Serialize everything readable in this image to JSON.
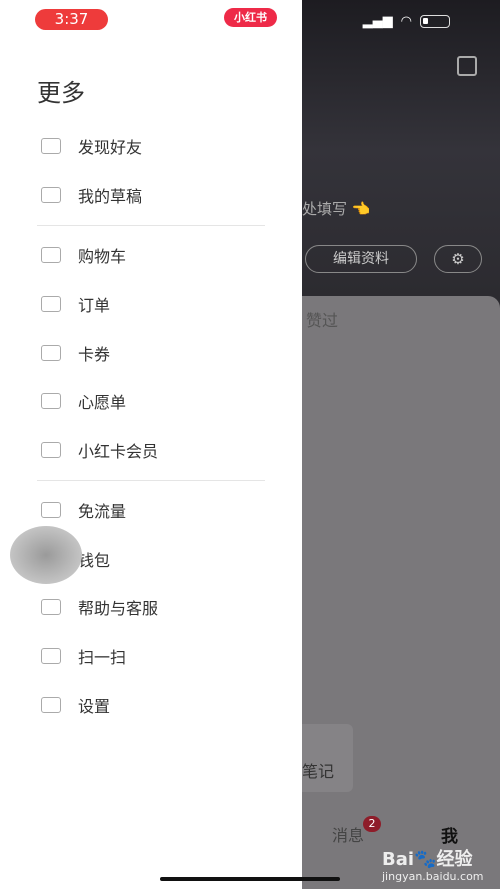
{
  "status": {
    "time": "3:37",
    "app_badge": "小红书"
  },
  "drawer": {
    "title": "更多",
    "items": [
      {
        "label": "发现好友",
        "icon": "add-user-icon"
      },
      {
        "label": "我的草稿",
        "icon": "inbox-icon"
      },
      {
        "label": "购物车",
        "icon": "cart-icon"
      },
      {
        "label": "订单",
        "icon": "order-icon"
      },
      {
        "label": "卡券",
        "icon": "coupon-icon"
      },
      {
        "label": "心愿单",
        "icon": "wishlist-icon"
      },
      {
        "label": "小红卡会员",
        "icon": "member-icon"
      },
      {
        "label": "免流量",
        "icon": "data-icon"
      },
      {
        "label": "钱包",
        "icon": "wallet-icon"
      },
      {
        "label": "帮助与客服",
        "icon": "headset-icon"
      },
      {
        "label": "扫一扫",
        "icon": "scan-icon"
      },
      {
        "label": "设置",
        "icon": "settings-icon"
      }
    ]
  },
  "profile": {
    "hint": "处填写 👈",
    "edit": "编辑资料",
    "tab_liked": "赞过",
    "note": "笔记"
  },
  "tabbar": {
    "messages": "消息",
    "messages_badge": "2",
    "me": "我"
  },
  "watermark": {
    "brand": "Bai🐾经验",
    "url": "jingyan.baidu.com"
  }
}
